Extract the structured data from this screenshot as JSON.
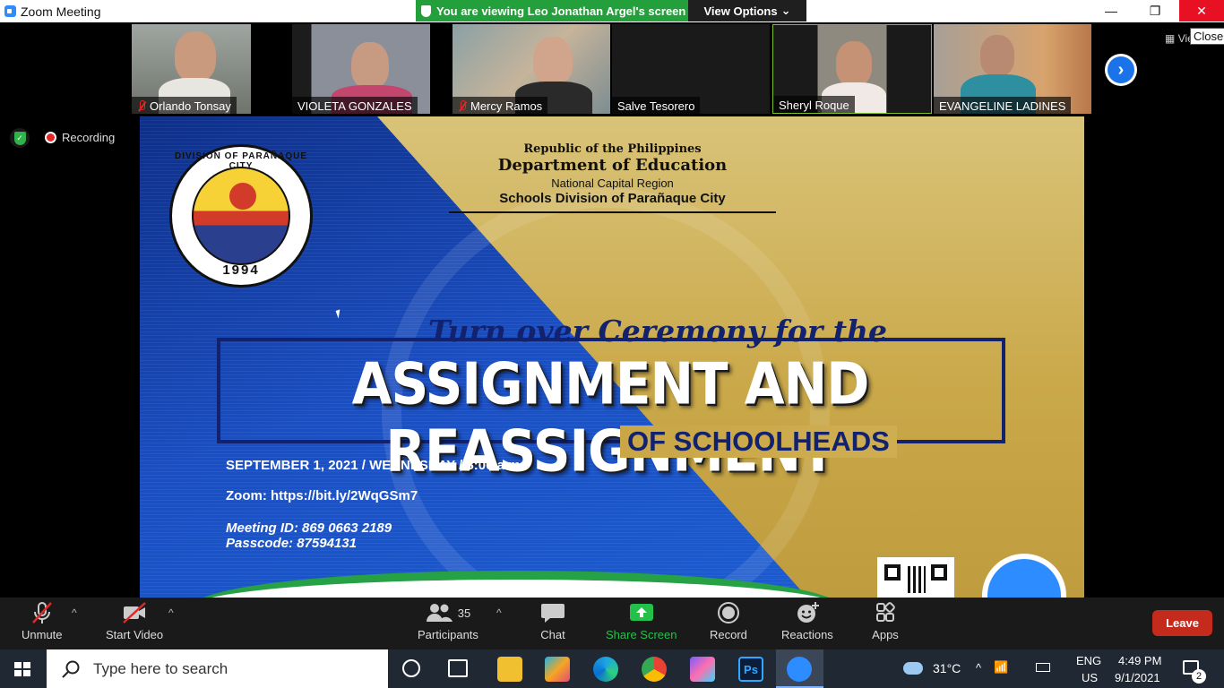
{
  "window": {
    "title": "Zoom Meeting",
    "viewing_banner": "You are viewing Leo Jonathan Argel's screen",
    "view_options": "View Options",
    "view_options_caret": "⌄",
    "minimize": "—",
    "maximize": "❐",
    "close": "✕",
    "close_tooltip": "Close",
    "view_label": "View"
  },
  "participants_strip": [
    {
      "name": "Orlando Tonsay",
      "muted": true
    },
    {
      "name": "VIOLETA GONZALES",
      "muted": false
    },
    {
      "name": "Mercy Ramos",
      "muted": true
    },
    {
      "name": "Salve Tesorero",
      "muted": false
    },
    {
      "name": "Sheryl Roque",
      "muted": false
    },
    {
      "name": "EVANGELINE LADINES",
      "muted": false
    }
  ],
  "next_page_icon": "›",
  "status": {
    "shield_glyph": "✓",
    "recording_label": "Recording"
  },
  "shared_screen": {
    "seal": {
      "arc_text": "DIVISION OF PARAÑAQUE CITY",
      "year": "1994"
    },
    "header": {
      "line1": "Republic of the Philippines",
      "line2": "Department of Education",
      "line3": "National Capital Region",
      "line4": "Schools Division of Parañaque City"
    },
    "subtitle_top": "Turn over Ceremony for the",
    "main_title": "ASSIGNMENT AND REASSIGNMENT",
    "subtitle_bottom": "OF SCHOOLHEADS",
    "date": "SEPTEMBER 1, 2021 / WEDNESDAY / 8:00 a.m.",
    "zoom_link": "Zoom: https://bit.ly/2WqGSm7",
    "meeting_id": "Meeting ID: 869 0663 2189",
    "passcode": "Passcode: 87594131"
  },
  "toolbar": {
    "unmute": "Unmute",
    "start_video": "Start Video",
    "participants": "Participants",
    "participants_count": "35",
    "chat": "Chat",
    "share_screen": "Share Screen",
    "record": "Record",
    "reactions": "Reactions",
    "apps": "Apps",
    "leave": "Leave",
    "caret": "^"
  },
  "taskbar": {
    "search_placeholder": "Type here to search",
    "weather": "31°C",
    "language_top": "ENG",
    "language_bottom": "US",
    "time": "4:49 PM",
    "date": "9/1/2021",
    "notifications_count": "2",
    "tray_caret": "^"
  },
  "colors": {
    "accent_green": "#23a03b",
    "close_red": "#e81123",
    "leave_red": "#c42b1c",
    "zoom_blue": "#2d8cff",
    "slide_navy": "#12226e"
  }
}
